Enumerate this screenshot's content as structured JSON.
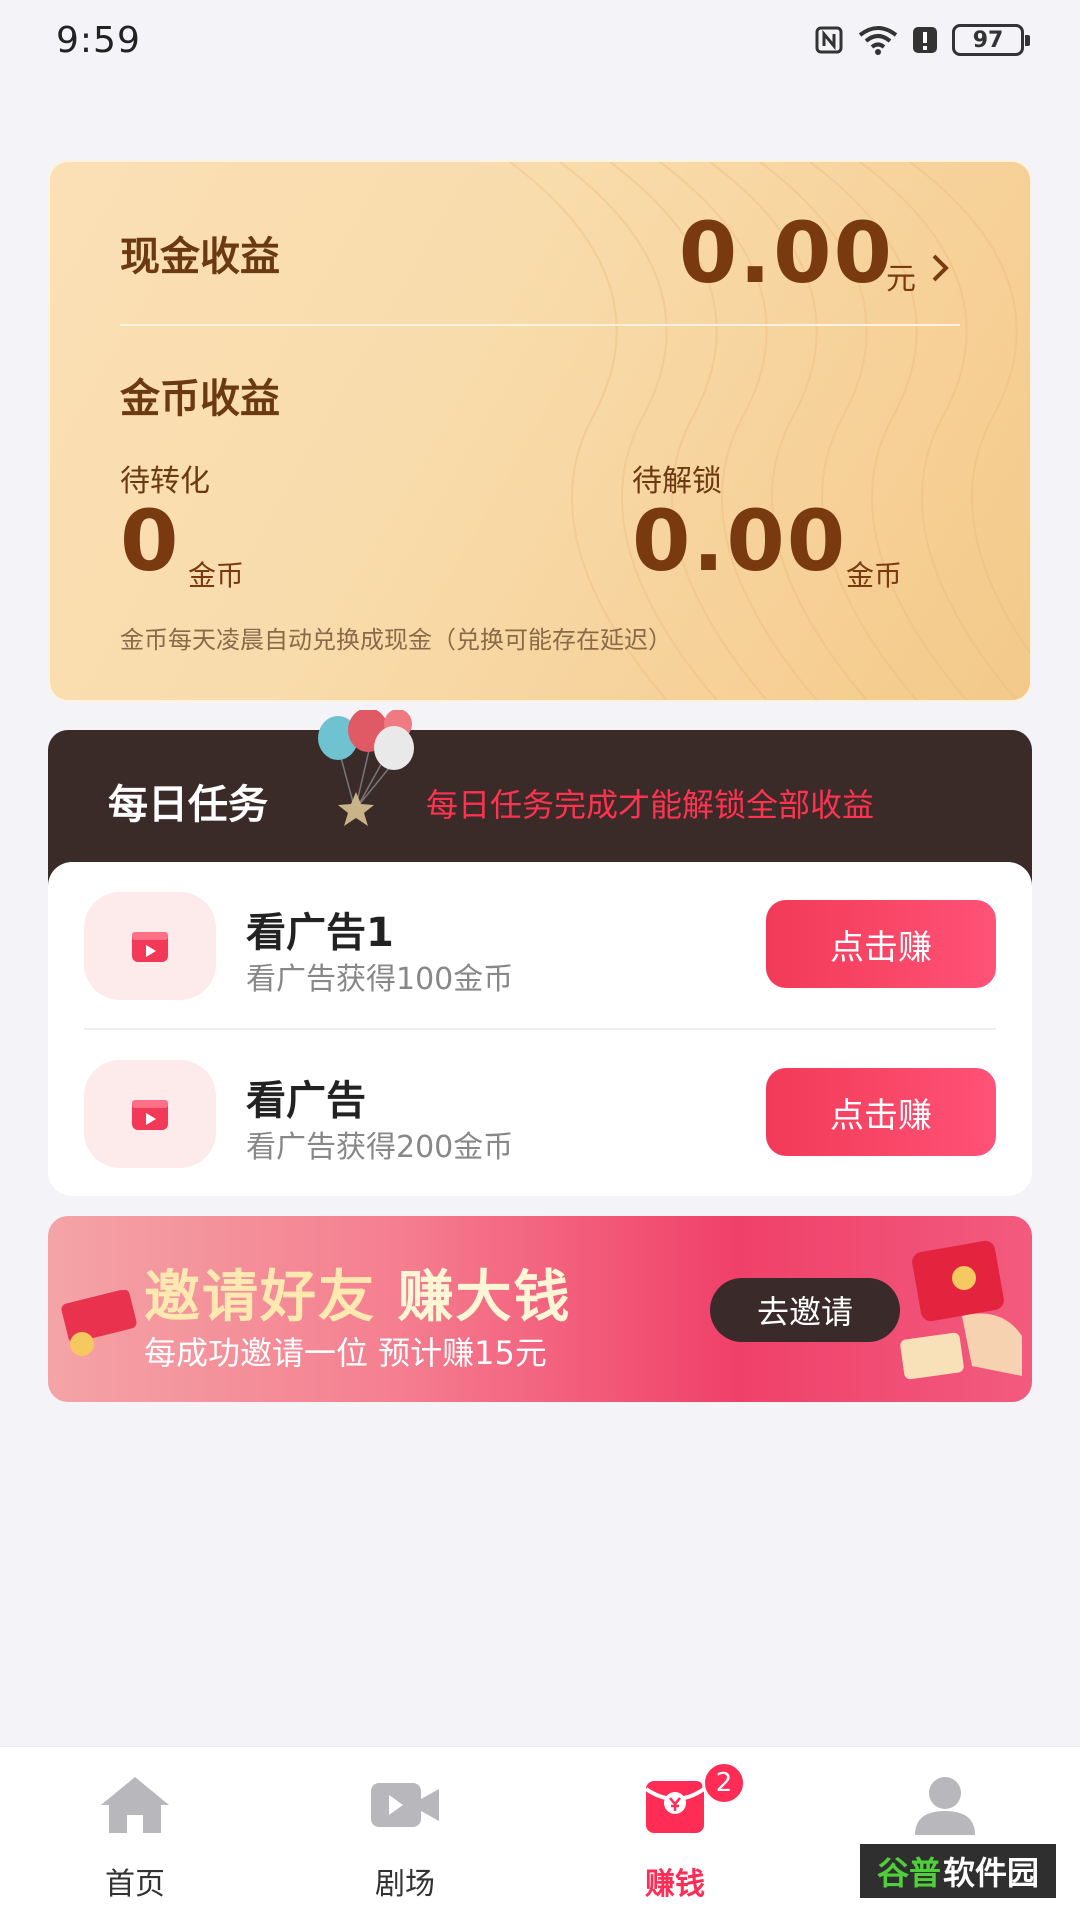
{
  "status_bar": {
    "time": "9:59",
    "battery": "97"
  },
  "earnings": {
    "cash_label": "现金收益",
    "cash_value": "0.00",
    "cash_unit": "元",
    "coin_label": "金币收益",
    "pending_label": "待转化",
    "pending_value": "0",
    "pending_unit": "金币",
    "unlock_label": "待解锁",
    "unlock_value": "0.00",
    "unlock_unit": "金币",
    "note": "金币每天凌晨自动兑换成现金（兑换可能存在延迟）"
  },
  "daily_tasks": {
    "title": "每日任务",
    "hint": "每日任务完成才能解锁全部收益",
    "items": [
      {
        "title": "看广告1",
        "subtitle": "看广告获得100金币",
        "button": "点击赚"
      },
      {
        "title": "看广告",
        "subtitle": "看广告获得200金币",
        "button": "点击赚"
      }
    ]
  },
  "invite": {
    "title_a": "邀请好友",
    "title_b": "赚大钱",
    "subtitle": "每成功邀请一位 预计赚15元",
    "button": "去邀请"
  },
  "tab_bar": {
    "tabs": [
      {
        "label": "首页",
        "icon": "home-icon"
      },
      {
        "label": "剧场",
        "icon": "video-camera-icon"
      },
      {
        "label": "赚钱",
        "icon": "red-envelope-icon",
        "badge": "2"
      },
      {
        "label": "我",
        "icon": "user-icon"
      }
    ],
    "active_index": 2
  },
  "watermark": {
    "text_a": "谷普",
    "text_b": "软件园"
  },
  "colors": {
    "accent": "#ff2d55",
    "card_gold": "#f9dcac",
    "brown_text": "#7a3a10",
    "dark_header": "#3a2a28"
  }
}
